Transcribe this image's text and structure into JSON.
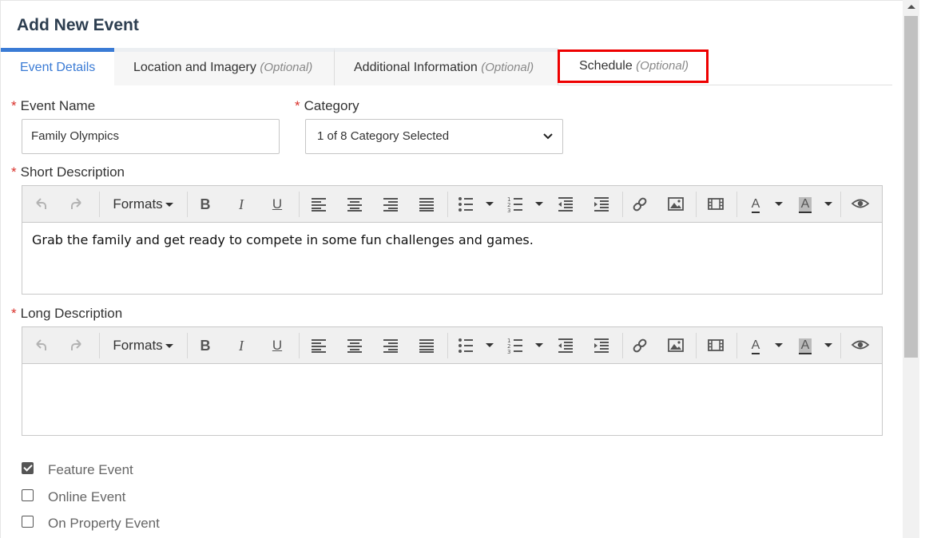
{
  "title": "Add New Event",
  "tabs": [
    {
      "label": "Event Details",
      "optional": ""
    },
    {
      "label": "Location and Imagery",
      "optional": "(Optional)"
    },
    {
      "label": "Additional Information",
      "optional": "(Optional)"
    },
    {
      "label": "Schedule",
      "optional": "(Optional)"
    }
  ],
  "required_marker": "*",
  "event_name": {
    "label": "Event Name",
    "value": "Family Olympics"
  },
  "category": {
    "label": "Category",
    "value": "1 of 8 Category Selected"
  },
  "short_description": {
    "label": "Short Description",
    "content": "Grab the family and get ready to compete in some fun challenges and games."
  },
  "long_description": {
    "label": "Long Description",
    "content": ""
  },
  "toolbar": {
    "formats_label": "Formats",
    "font_color_glyph": "A",
    "bg_color_glyph": "A"
  },
  "checkboxes": [
    {
      "label": "Feature Event",
      "checked": true
    },
    {
      "label": "Online Event",
      "checked": false
    },
    {
      "label": "On Property Event",
      "checked": false
    }
  ],
  "colors": {
    "accent": "#3a7bd5",
    "required": "#d9302a",
    "highlight": "#e00000"
  }
}
